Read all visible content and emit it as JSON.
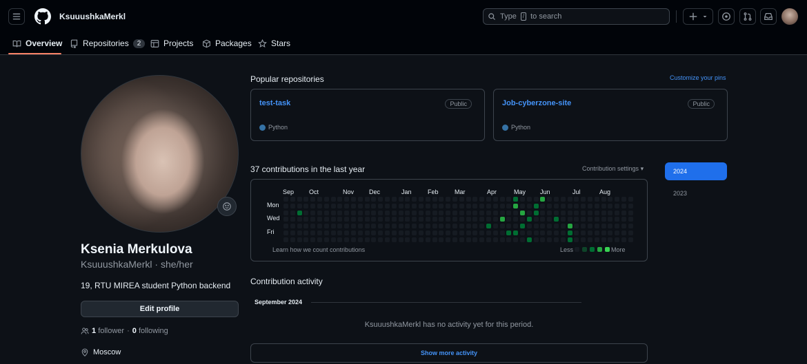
{
  "header": {
    "username": "KsuuushkaMerkl",
    "search_prefix": "Type",
    "search_key": "/",
    "search_suffix": "to search"
  },
  "tabs": [
    {
      "label": "Overview",
      "icon": "book-icon"
    },
    {
      "label": "Repositories",
      "icon": "repo-icon",
      "count": "2"
    },
    {
      "label": "Projects",
      "icon": "table-icon"
    },
    {
      "label": "Packages",
      "icon": "package-icon"
    },
    {
      "label": "Stars",
      "icon": "star-icon"
    }
  ],
  "profile": {
    "name": "Ksenia Merkulova",
    "login": "KsuuushkaMerkl",
    "pronouns": "she/her",
    "bio": "19, RTU MIREA student Python backend",
    "edit_label": "Edit profile",
    "followers": "1",
    "followers_label": "follower",
    "following": "0",
    "following_label": "following",
    "location": "Moscow"
  },
  "popular": {
    "title": "Popular repositories",
    "customize": "Customize your pins",
    "repos": [
      {
        "name": "test-task",
        "visibility": "Public",
        "language": "Python"
      },
      {
        "name": "Job-cyberzone-site",
        "visibility": "Public",
        "language": "Python"
      }
    ]
  },
  "contributions": {
    "title": "37 contributions in the last year",
    "settings": "Contribution settings",
    "months": [
      "Sep",
      "Oct",
      "Nov",
      "Dec",
      "Jan",
      "Feb",
      "Mar",
      "Apr",
      "May",
      "Jun",
      "Jul",
      "Aug"
    ],
    "days": [
      "Mon",
      "Wed",
      "Fri"
    ],
    "learn": "Learn how we count contributions",
    "less": "Less",
    "more": "More",
    "years": [
      "2024",
      "2023"
    ],
    "colors": {
      "empty": "#161b22",
      "l1": "#0e4429",
      "l2": "#006d32",
      "l3": "#26a641",
      "l4": "#39d353"
    }
  },
  "activity": {
    "title": "Contribution activity",
    "month": "September 2024",
    "empty": "KsuuushkaMerkl has no activity yet for this period.",
    "show_more": "Show more activity"
  }
}
